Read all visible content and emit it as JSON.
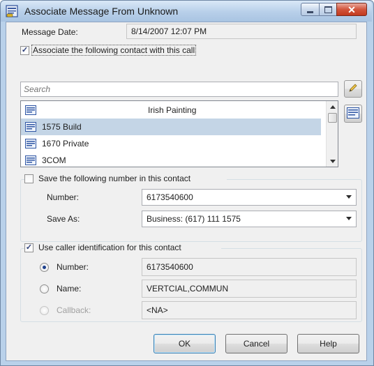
{
  "window": {
    "title": "Associate Message From Unknown"
  },
  "message_date": {
    "label": "Message Date:",
    "value": "8/14/2007 12:07 PM"
  },
  "associate_contact": {
    "label": "Associate the following contact with this call",
    "checked": true
  },
  "search": {
    "placeholder": "Search"
  },
  "contact_list": {
    "items": [
      {
        "label": "Irish Painting"
      },
      {
        "label": "1575 Build"
      },
      {
        "label": "1670 Private"
      },
      {
        "label": "3COM"
      }
    ],
    "selected_index": 1
  },
  "save_number": {
    "label": "Save the following number in this contact",
    "checked": false,
    "number_label": "Number:",
    "number_value": "6173540600",
    "save_as_label": "Save As:",
    "save_as_value": "Business: (617) 111 1575"
  },
  "caller_id": {
    "label": "Use caller identification for this contact",
    "checked": true,
    "options": [
      {
        "label": "Number:",
        "value": "6173540600",
        "selected": true,
        "disabled": false
      },
      {
        "label": "Name:",
        "value": "VERTCIAL,COMMUN",
        "selected": false,
        "disabled": false
      },
      {
        "label": "Callback:",
        "value": "<NA>",
        "selected": false,
        "disabled": true
      }
    ]
  },
  "buttons": {
    "ok": "OK",
    "cancel": "Cancel",
    "help": "Help"
  },
  "colors": {
    "selection": "#c4d5e6",
    "frame": "#b9d1ea",
    "dialog_bg": "#f0f0f0"
  }
}
